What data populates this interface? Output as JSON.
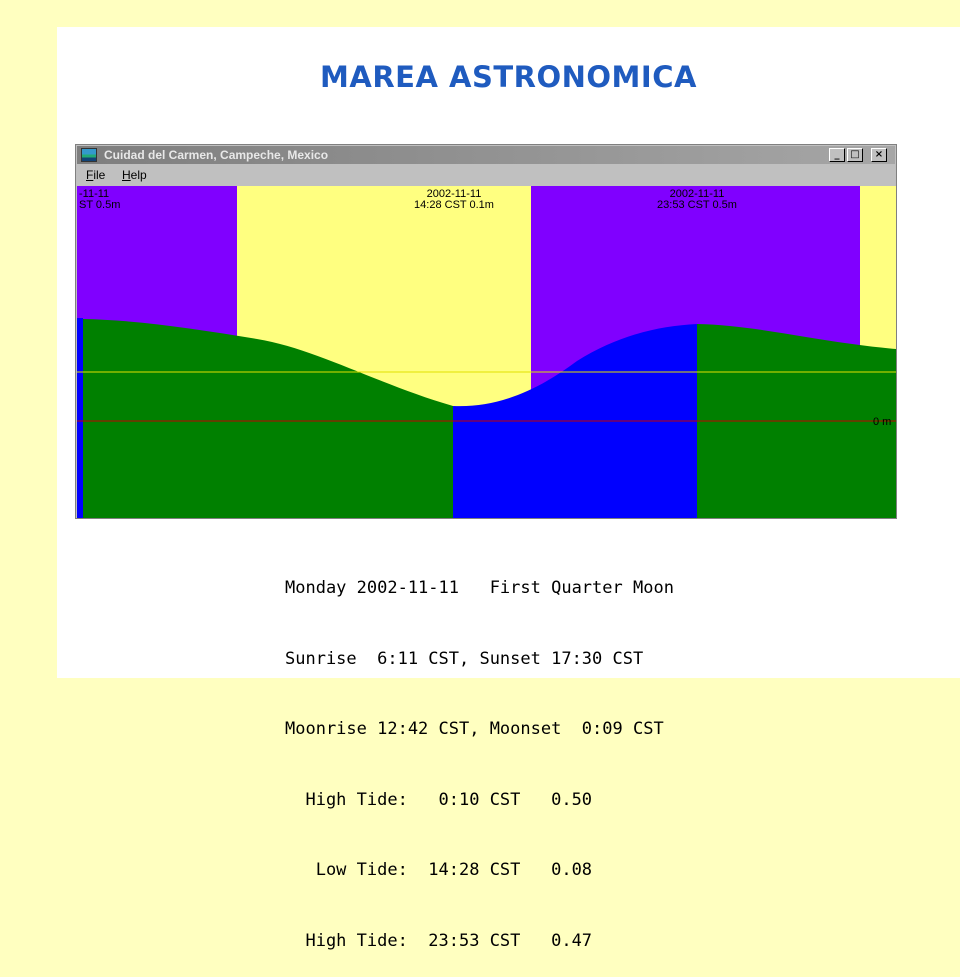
{
  "slide": {
    "title": "MAREA ASTRONOMICA"
  },
  "window": {
    "title": "Cuidad del Carmen, Campeche, Mexico",
    "icon": "tide-app-icon",
    "controls": {
      "minimize": "_",
      "maximize": "□",
      "close": "×"
    }
  },
  "menu": {
    "items": [
      {
        "label": "File",
        "accel": "F",
        "rest": "ile"
      },
      {
        "label": "Help",
        "accel": "H",
        "rest": "elp"
      }
    ]
  },
  "chart_data": {
    "type": "area",
    "zero_label": "0 m",
    "annotations": [
      {
        "line1": "-11-11",
        "line2": "ST 0.5m"
      },
      {
        "line1": "2002-11-11",
        "line2": "14:28 CST 0.1m"
      },
      {
        "line1": "2002-11-11",
        "line2": "23:53 CST 0.5m"
      }
    ],
    "colors": {
      "night": "#8000ff",
      "day": "#ffff80",
      "falling_tide": "#008000",
      "rising_tide": "#0000ff",
      "zero_line": "#c00000",
      "mean_line": "#e0e000"
    }
  },
  "readout": {
    "lines": [
      "Monday 2002-11-11   First Quarter Moon",
      "Sunrise  6:11 CST, Sunset 17:30 CST",
      "Moonrise 12:42 CST, Moonset  0:09 CST",
      "  High Tide:   0:10 CST   0.50",
      "   Low Tide:  14:28 CST   0.08",
      "  High Tide:  23:53 CST   0.47"
    ]
  }
}
